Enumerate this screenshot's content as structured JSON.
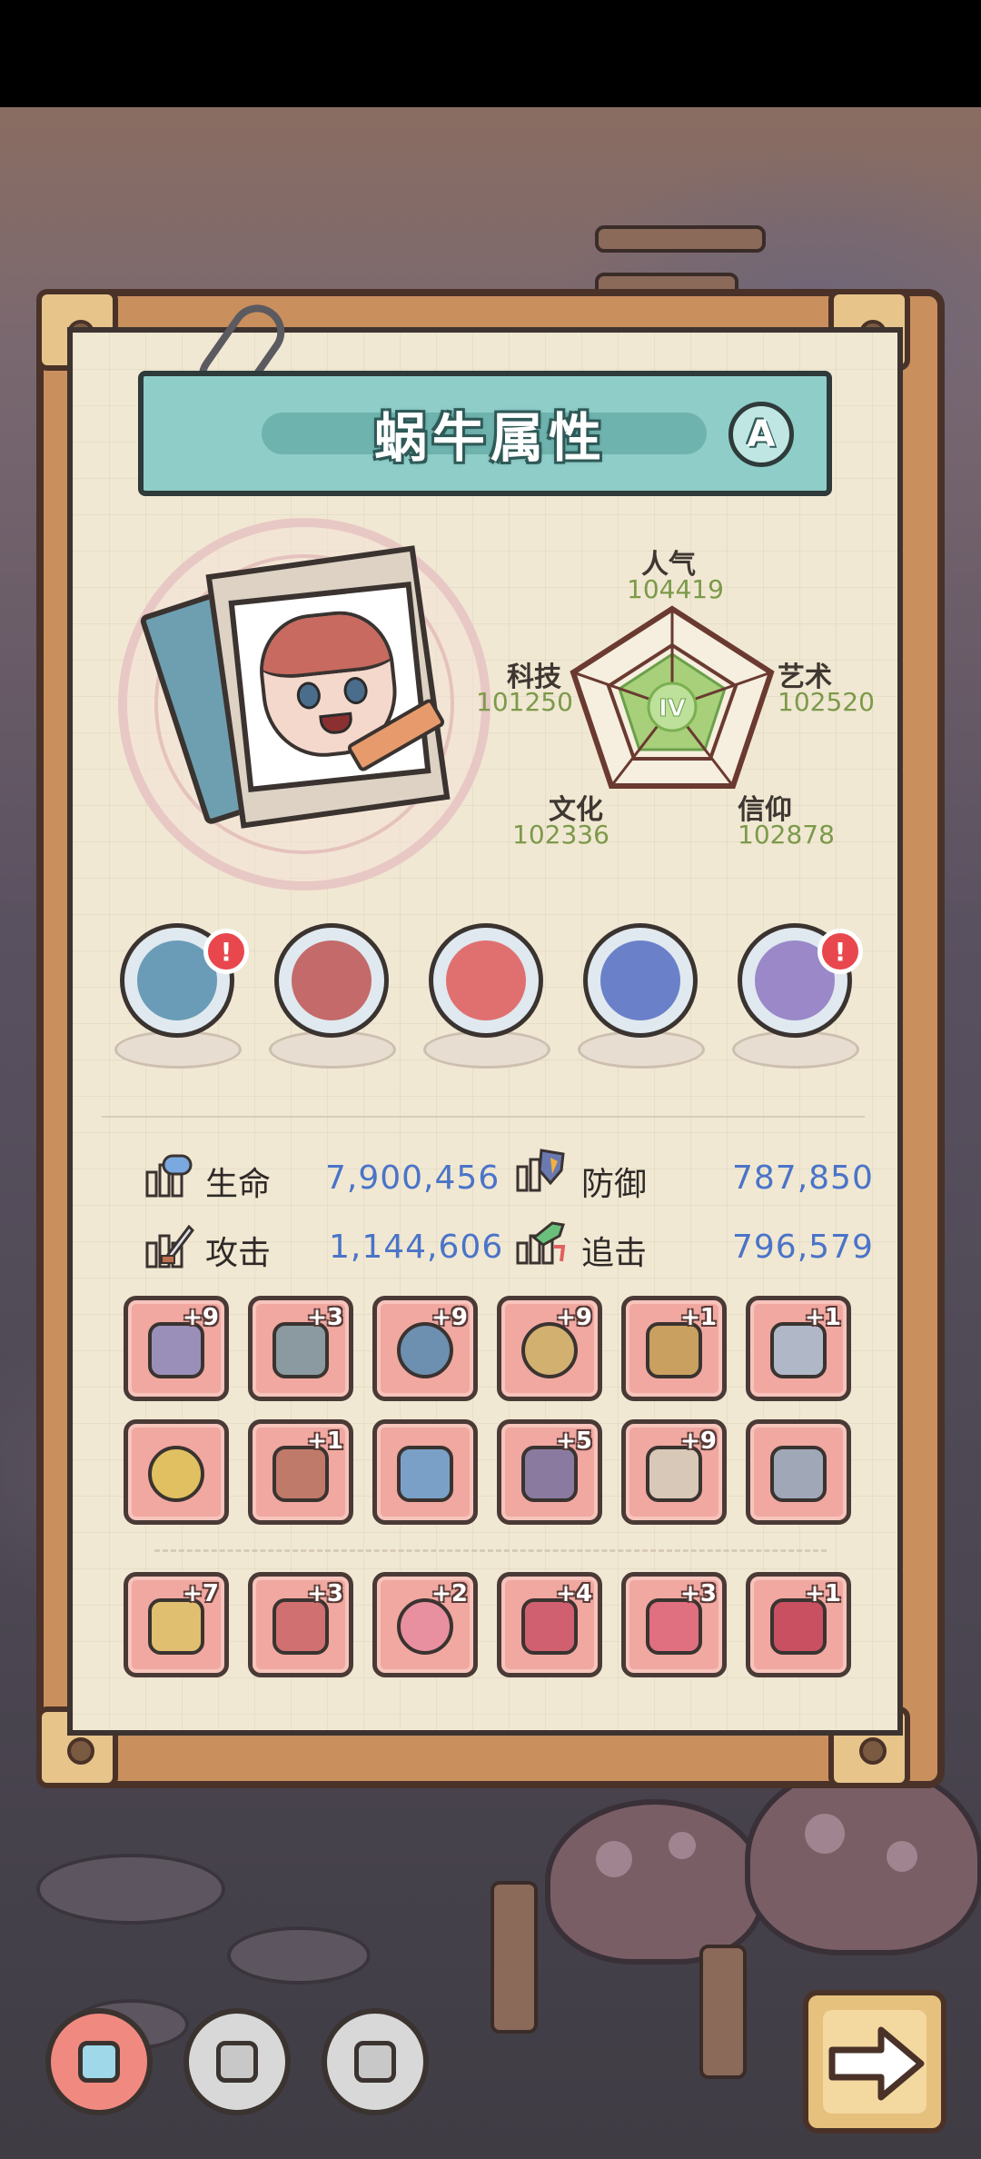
{
  "panel": {
    "title": "蜗牛属性",
    "grade_badge": "A"
  },
  "radar": {
    "level": "IV",
    "stats": [
      {
        "name": "人气",
        "value": "104419"
      },
      {
        "name": "艺术",
        "value": "102520"
      },
      {
        "name": "信仰",
        "value": "102878"
      },
      {
        "name": "文化",
        "value": "102336"
      },
      {
        "name": "科技",
        "value": "101250"
      }
    ]
  },
  "treasures": [
    {
      "name": "monster-fish",
      "alert": "!"
    },
    {
      "name": "fang-mask",
      "alert": ""
    },
    {
      "name": "red-orb",
      "alert": ""
    },
    {
      "name": "compass",
      "alert": ""
    },
    {
      "name": "crystal-cubes",
      "alert": "!"
    }
  ],
  "attributes": [
    {
      "label": "生命",
      "value": "7,900,456"
    },
    {
      "label": "防御",
      "value": "787,850"
    },
    {
      "label": "攻击",
      "value": "1,144,606"
    },
    {
      "label": "追击",
      "value": "796,579"
    }
  ],
  "equipment": [
    {
      "item": "dagger",
      "level": "+9",
      "color": "#9a8fb8"
    },
    {
      "item": "backpack",
      "level": "+3",
      "color": "#8a9aa0"
    },
    {
      "item": "bracelet",
      "level": "+9",
      "color": "#6d8fb0"
    },
    {
      "item": "mech-core",
      "level": "+9",
      "color": "#d2b070"
    },
    {
      "item": "trumpet",
      "level": "+1",
      "color": "#c9a060"
    },
    {
      "item": "rocket-sword",
      "level": "+1",
      "color": "#b0b8c8"
    },
    {
      "item": "golden-ring",
      "level": "",
      "color": "#e0c060"
    },
    {
      "item": "spear",
      "level": "+1",
      "color": "#c07a6a"
    },
    {
      "item": "blue-sword",
      "level": "",
      "color": "#7aa0c8"
    },
    {
      "item": "serpent-staff",
      "level": "+5",
      "color": "#8a7aa0"
    },
    {
      "item": "pants",
      "level": "+9",
      "color": "#d8c8b8"
    },
    {
      "item": "crossbow",
      "level": "",
      "color": "#a0a8b8"
    },
    {
      "item": "treasure-chest",
      "level": "+7",
      "color": "#e0c070"
    },
    {
      "item": "winged-helm",
      "level": "+3",
      "color": "#d07070"
    },
    {
      "item": "flower-shield",
      "level": "+2",
      "color": "#e890a0"
    },
    {
      "item": "helmet",
      "level": "+4",
      "color": "#d06070"
    },
    {
      "item": "boots",
      "level": "+3",
      "color": "#e07080"
    },
    {
      "item": "armor",
      "level": "+1",
      "color": "#c85060"
    }
  ],
  "nav": {
    "tabs": [
      "snail-attributes",
      "stats-board",
      "skill-tree"
    ],
    "active_tab": "snail-attributes",
    "next_label": "next-arrow"
  },
  "colors": {
    "banner": "#8fcdc8",
    "slot_bg": "#f0a8a1",
    "value_blue": "#4a74c8",
    "radar_value_green": "#7c9a4a",
    "alert_red": "#e8474d"
  }
}
